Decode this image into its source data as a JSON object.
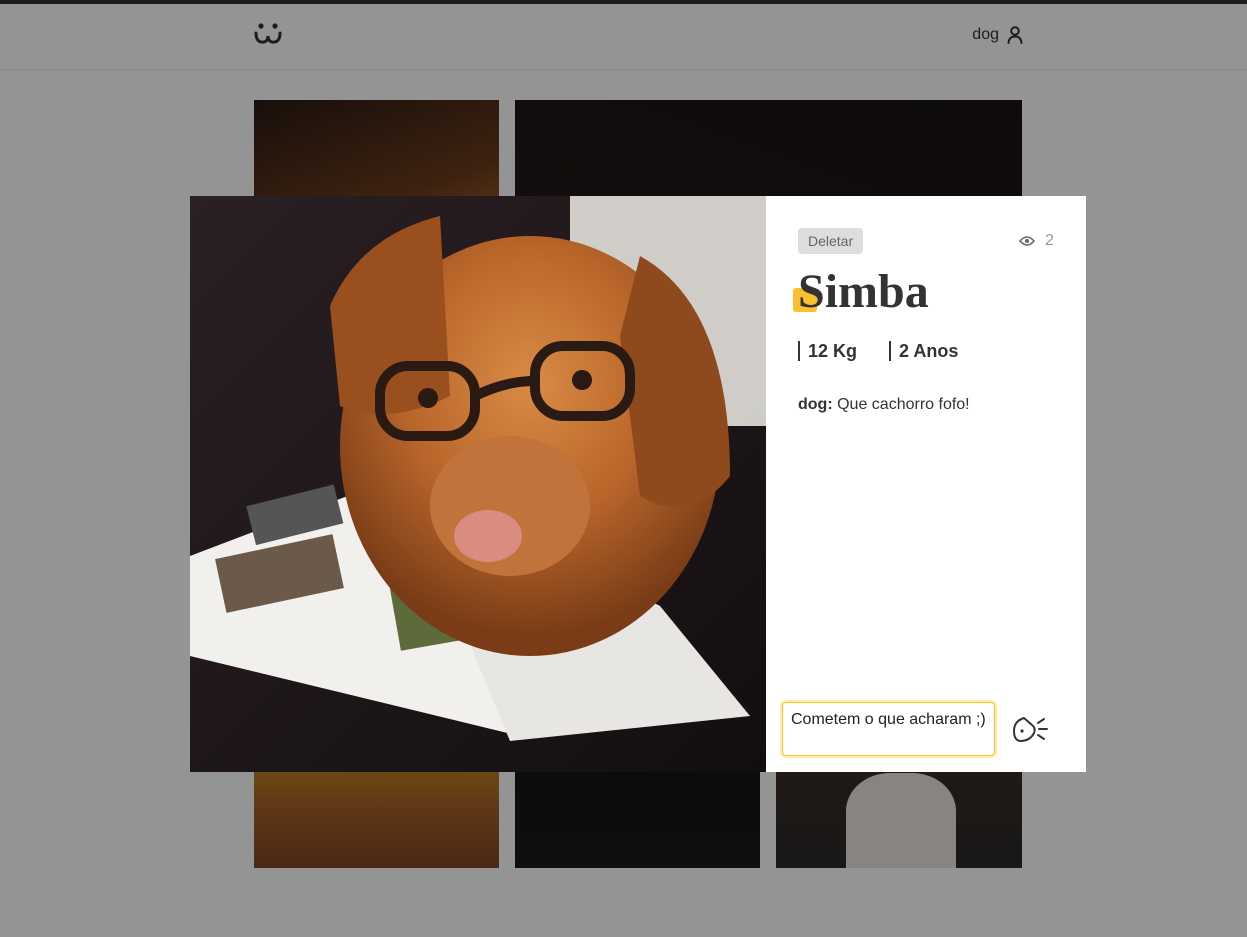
{
  "header": {
    "username": "dog",
    "logo_icon": "dog-face-icon",
    "user_icon": "user-icon"
  },
  "feed": {
    "photos": [
      {
        "name": "photo-1"
      },
      {
        "name": "photo-2"
      },
      {
        "name": "photo-3"
      },
      {
        "name": "photo-4"
      },
      {
        "name": "photo-5"
      },
      {
        "name": "photo-6"
      }
    ]
  },
  "modal": {
    "delete_label": "Deletar",
    "views": "2",
    "title": "Simba",
    "weight": "12 Kg",
    "age": "2 Anos",
    "comment": {
      "author": "dog:",
      "text": "Que cachorro fofo!"
    },
    "comment_input_value": "Cometem o que acharam ;)",
    "colors": {
      "accent": "#fbc02d",
      "text": "#333333",
      "overlay": "rgba(0,0,0,0.42)"
    }
  }
}
